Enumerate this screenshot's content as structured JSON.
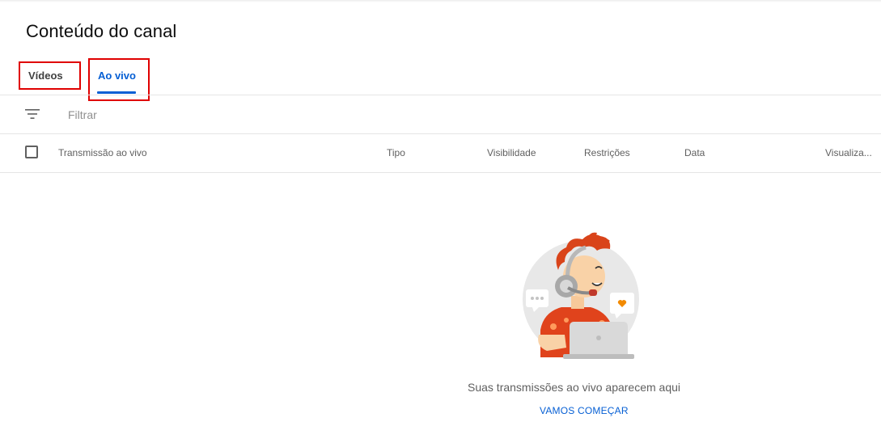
{
  "page": {
    "title": "Conteúdo do canal"
  },
  "tabs": [
    {
      "label": "Vídeos",
      "active": false
    },
    {
      "label": "Ao vivo",
      "active": true
    }
  ],
  "filter": {
    "placeholder": "Filtrar",
    "icon": "filter-icon"
  },
  "table": {
    "columns": [
      "Transmissão ao vivo",
      "Tipo",
      "Visibilidade",
      "Restrições",
      "Data",
      "Visualiza..."
    ]
  },
  "empty_state": {
    "message": "Suas transmissões ao vivo aparecem aqui",
    "action_label": "VAMOS COMEÇAR"
  },
  "colors": {
    "accent": "#065fd4",
    "highlight": "#e00000"
  }
}
